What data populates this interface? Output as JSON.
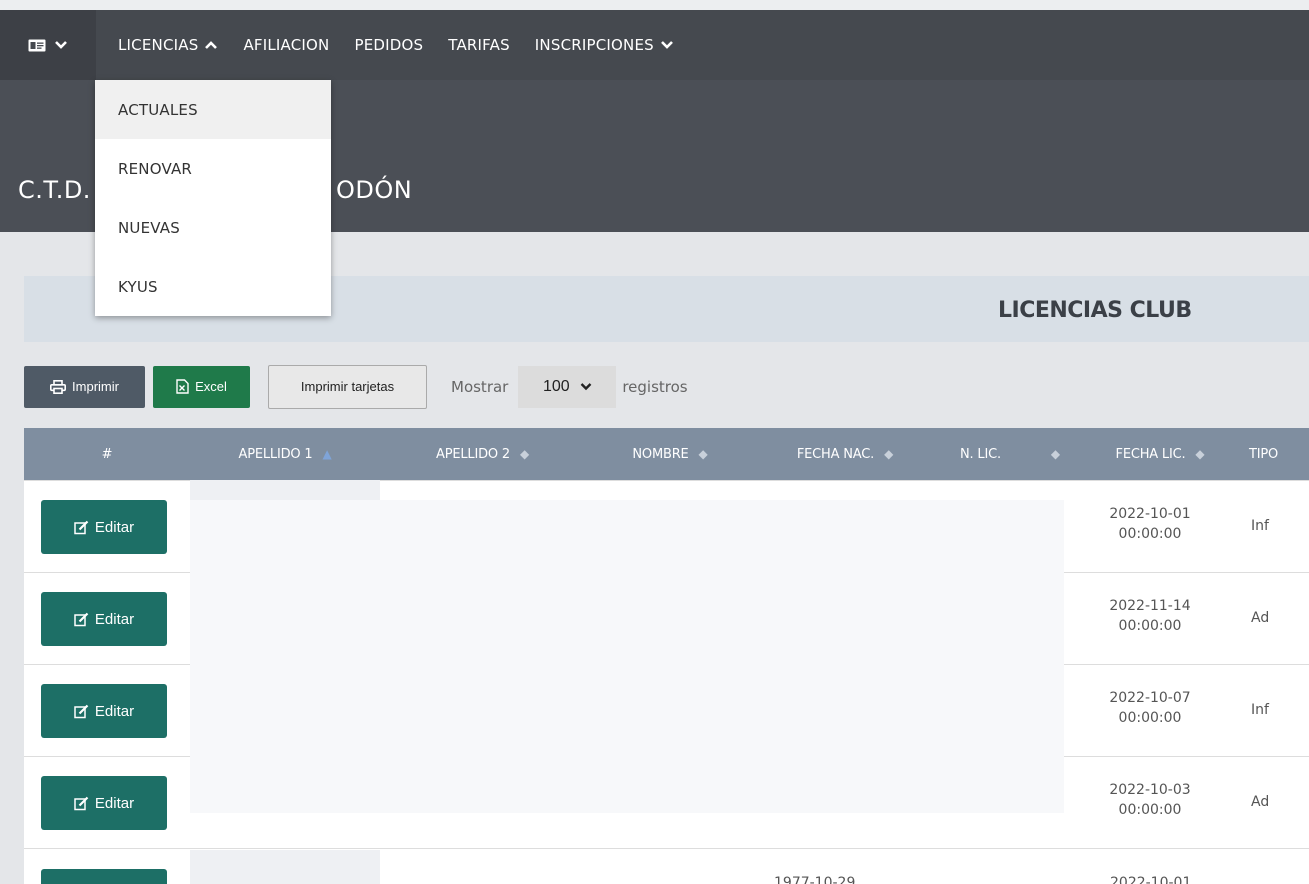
{
  "nav": {
    "items": [
      {
        "label": "LICENCIAS",
        "icon": "chevron-up-icon"
      },
      {
        "label": "AFILIACION"
      },
      {
        "label": "PEDIDOS"
      },
      {
        "label": "TARIFAS"
      },
      {
        "label": "INSCRIPCIONES",
        "icon": "chevron-down-icon"
      }
    ],
    "brand_icon": "id-card-icon"
  },
  "dropdown": {
    "items": [
      "ACTUALES",
      "RENOVAR",
      "NUEVAS",
      "KYUS"
    ],
    "active": "ACTUALES"
  },
  "club": {
    "title_left": "C.T.D.",
    "title_right": "ODÓN"
  },
  "panel": {
    "title": "LICENCIAS CLUB"
  },
  "toolbar": {
    "print_label": "Imprimir",
    "excel_label": "Excel",
    "cards_label": "Imprimir tarjetas",
    "show_label": "Mostrar",
    "page_size": "100",
    "records_label": "registros"
  },
  "table": {
    "columns": [
      "#",
      "APELLIDO 1",
      "APELLIDO 2",
      "NOMBRE",
      "FECHA NAC.",
      "N. LIC.",
      "FECHA LIC.",
      "TIPO"
    ],
    "edit_label": "Editar",
    "rows": [
      {
        "fecha_lic_date": "2022-10-01",
        "fecha_lic_time": "00:00:00",
        "tipo": "Inf"
      },
      {
        "fecha_lic_date": "2022-11-14",
        "fecha_lic_time": "00:00:00",
        "tipo": "Ad"
      },
      {
        "fecha_lic_date": "2022-10-07",
        "fecha_lic_time": "00:00:00",
        "tipo": "Inf"
      },
      {
        "fecha_lic_date": "2022-10-03",
        "fecha_lic_time": "00:00:00",
        "tipo": "Ad"
      },
      {
        "fecha_nac": "1977-10-29",
        "fecha_lic_date": "2022-10-01"
      }
    ]
  },
  "colors": {
    "navbar": "#45494f",
    "table_header": "#7f8ea0",
    "edit_button": "#1d6f66",
    "excel_button": "#1f7a4a"
  }
}
